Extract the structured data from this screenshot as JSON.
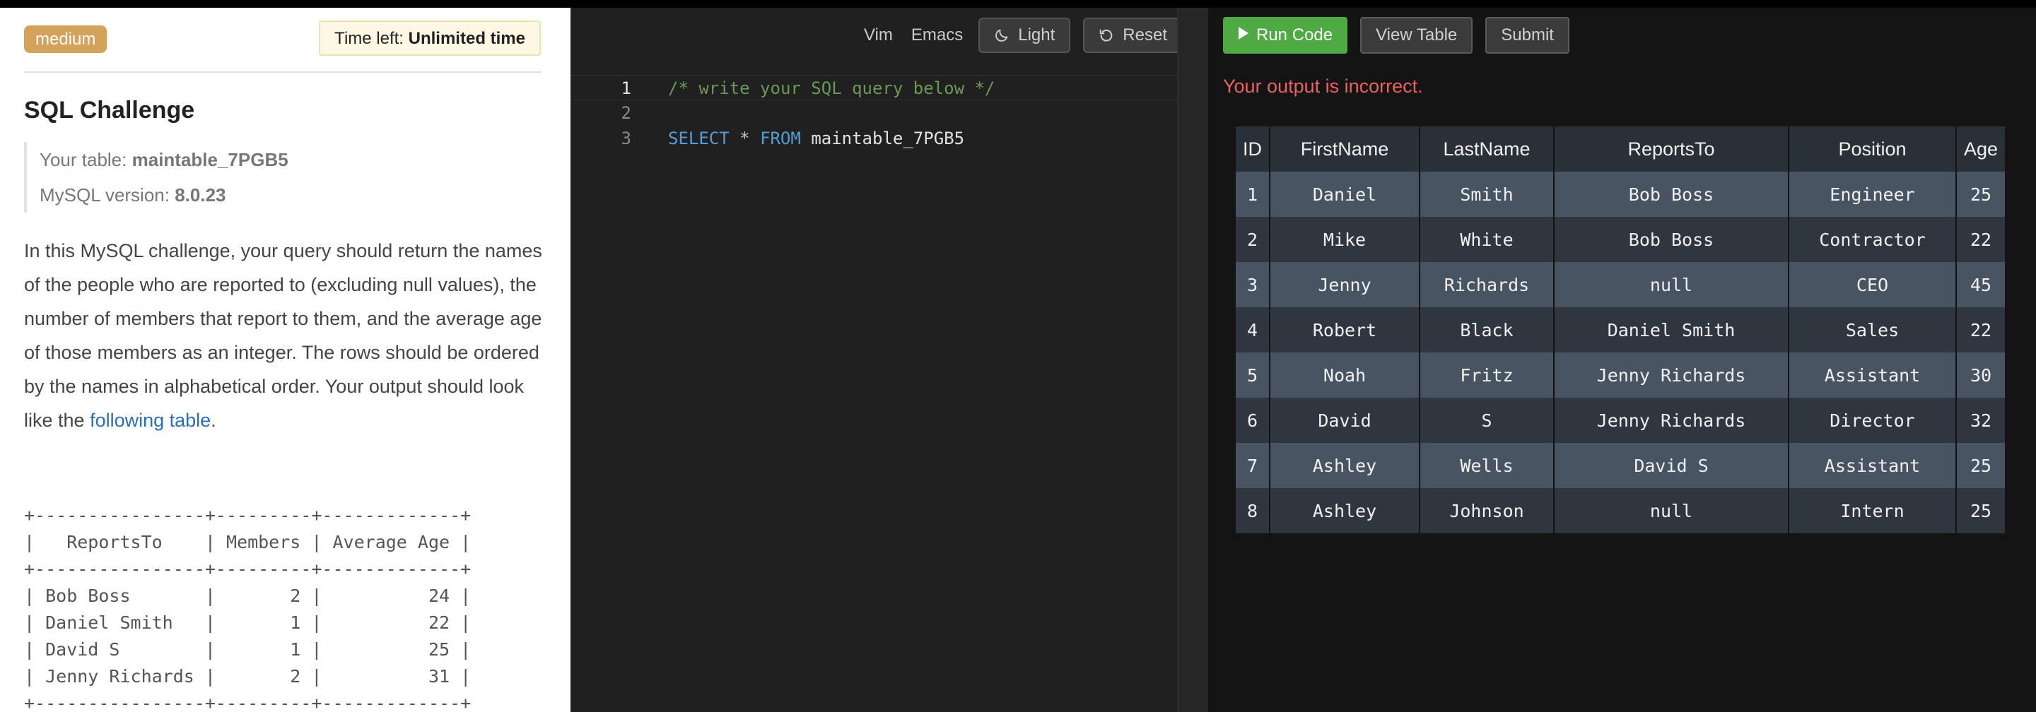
{
  "problem": {
    "difficulty": "medium",
    "timer_label": "Time left:",
    "timer_value": "Unlimited time",
    "title": "SQL Challenge",
    "table_label": "Your table:",
    "table_name": "maintable_7PGB5",
    "version_label": "MySQL version:",
    "version_value": "8.0.23",
    "description": "In this MySQL challenge, your query should return the names of the people who are reported to (excluding null values), the number of members that report to them, and the average age of those members as an integer. The rows should be ordered by the names in alphabetical order. Your output should look like the ",
    "link_text": "following table",
    "after_link": ".",
    "expected_output": "+----------------+---------+-------------+\n|   ReportsTo    | Members | Average Age |\n+----------------+---------+-------------+\n| Bob Boss       |       2 |          24 |\n| Daniel Smith   |       1 |          22 |\n| David S        |       1 |          25 |\n| Jenny Richards |       2 |          31 |\n+----------------+---------+-------------+"
  },
  "editor": {
    "vim_label": "Vim",
    "emacs_label": "Emacs",
    "theme_label": "Light",
    "reset_label": "Reset",
    "lines": [
      {
        "num": "1",
        "comment": "/* write your SQL query below */"
      },
      {
        "num": "2"
      },
      {
        "num": "3",
        "kw1": "SELECT",
        "op": "*",
        "kw2": "FROM",
        "ident": "maintable_7PGB5"
      }
    ]
  },
  "output": {
    "run_label": "Run Code",
    "view_table_label": "View Table",
    "submit_label": "Submit",
    "status": "Your output is incorrect.",
    "columns": [
      "ID",
      "FirstName",
      "LastName",
      "ReportsTo",
      "Position",
      "Age"
    ],
    "rows": [
      [
        "1",
        "Daniel",
        "Smith",
        "Bob Boss",
        "Engineer",
        "25"
      ],
      [
        "2",
        "Mike",
        "White",
        "Bob Boss",
        "Contractor",
        "22"
      ],
      [
        "3",
        "Jenny",
        "Richards",
        "null",
        "CEO",
        "45"
      ],
      [
        "4",
        "Robert",
        "Black",
        "Daniel Smith",
        "Sales",
        "22"
      ],
      [
        "5",
        "Noah",
        "Fritz",
        "Jenny Richards",
        "Assistant",
        "30"
      ],
      [
        "6",
        "David",
        "S",
        "Jenny Richards",
        "Director",
        "32"
      ],
      [
        "7",
        "Ashley",
        "Wells",
        "David S",
        "Assistant",
        "25"
      ],
      [
        "8",
        "Ashley",
        "Johnson",
        "null",
        "Intern",
        "25"
      ]
    ]
  },
  "colors": {
    "difficulty_badge": "#d4a35b",
    "run_button": "#4faa44",
    "error_text": "#e8625f",
    "link": "#2a6ebb"
  }
}
